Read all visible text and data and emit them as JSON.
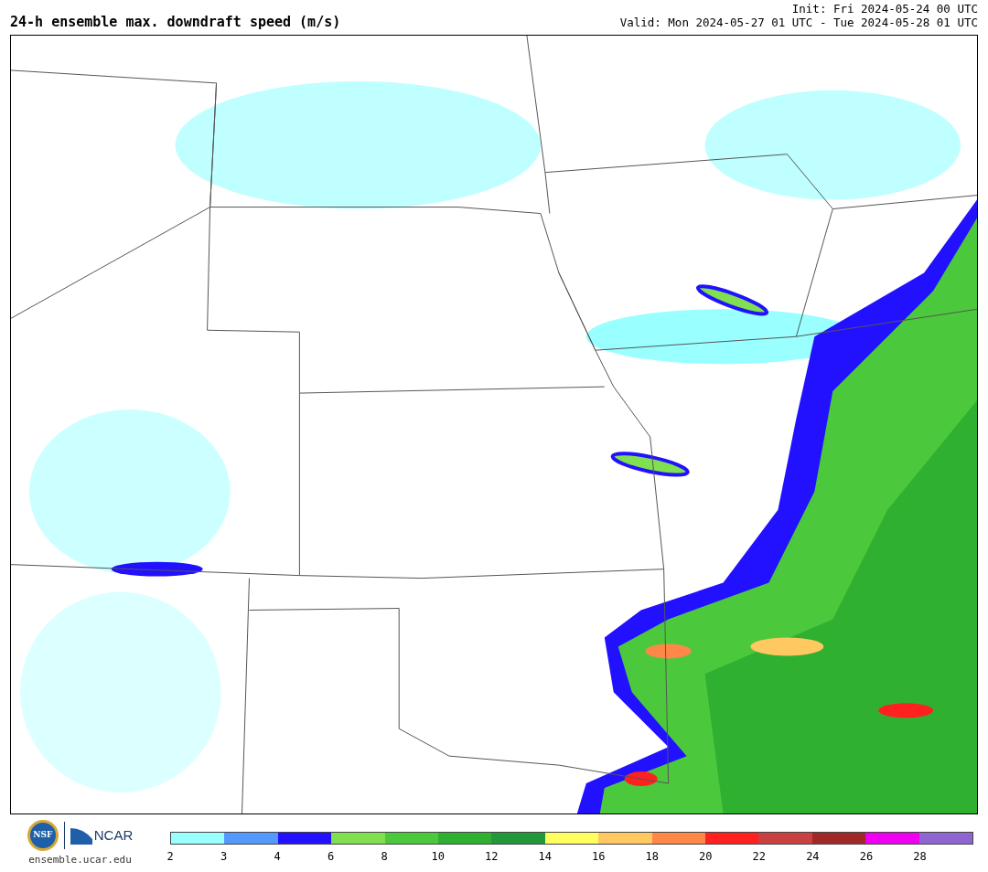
{
  "header": {
    "title": "24-h ensemble max. downdraft speed (m/s)",
    "init": "Init: Fri 2024-05-24 00 UTC",
    "valid": "Valid: Mon 2024-05-27 01 UTC - Tue 2024-05-28 01 UTC"
  },
  "footer": {
    "nsf_logo": "NSF",
    "ncar_logo": "NCAR",
    "url": "ensemble.ucar.edu"
  },
  "legend": {
    "colors": [
      {
        "color": "#99ffff"
      },
      {
        "color": "#5599ff"
      },
      {
        "color": "#2211ff"
      },
      {
        "color": "#80e050"
      },
      {
        "color": "#4cc83c"
      },
      {
        "color": "#30b030"
      },
      {
        "color": "#22983a"
      },
      {
        "color": "#ffff60"
      },
      {
        "color": "#ffc860"
      },
      {
        "color": "#ff8848"
      },
      {
        "color": "#ff2020"
      },
      {
        "color": "#c84040"
      },
      {
        "color": "#a02828"
      },
      {
        "color": "#f000f0"
      },
      {
        "color": "#8f66d0"
      }
    ],
    "ticks": [
      "2",
      "3",
      "4",
      "6",
      "8",
      "10",
      "12",
      "14",
      "16",
      "18",
      "20",
      "22",
      "24",
      "26",
      "28"
    ]
  }
}
